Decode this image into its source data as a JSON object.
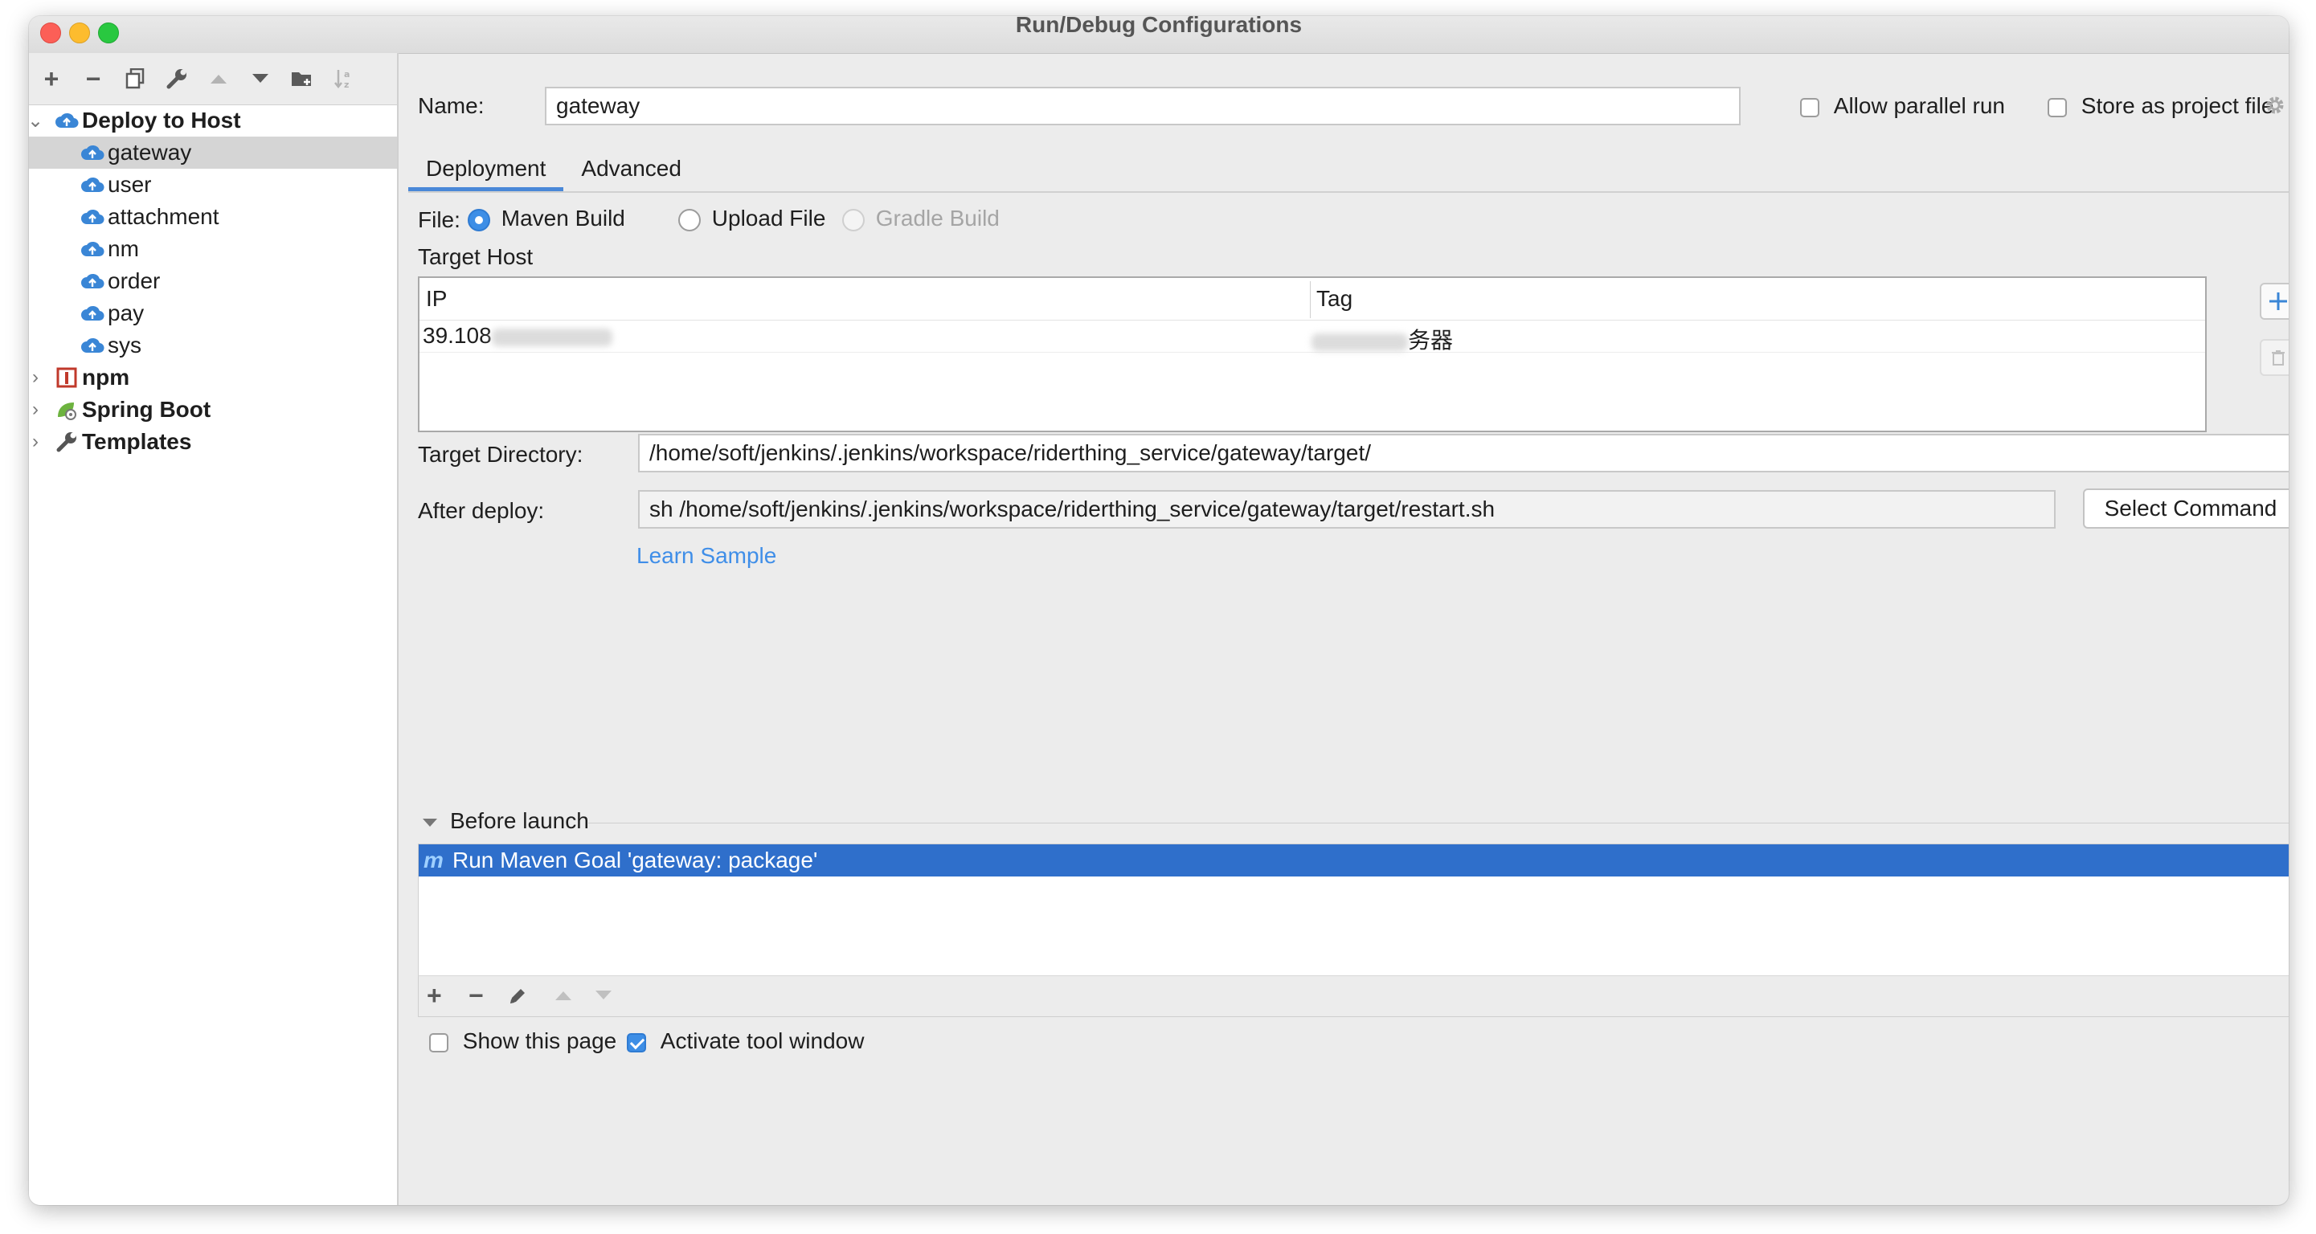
{
  "window": {
    "title": "Run/Debug Configurations"
  },
  "toolbar": {
    "add": "+",
    "remove": "−",
    "copy": "copy-icon",
    "edit": "wrench-icon",
    "up": "▲",
    "down": "▼",
    "folder": "folder-icon",
    "sort": "sort-icon"
  },
  "tree": {
    "deploy_group": "Deploy to Host",
    "items": [
      "gateway",
      "user",
      "attachment",
      "nm",
      "order",
      "pay",
      "sys"
    ],
    "npm": "npm",
    "spring_boot": "Spring Boot",
    "templates": "Templates"
  },
  "form": {
    "name_label": "Name:",
    "name_value": "gateway",
    "allow_parallel": "Allow parallel run",
    "store_project": "Store as project file",
    "tabs": [
      "Deployment",
      "Advanced"
    ],
    "file_label": "File:",
    "file_options": [
      "Maven Build",
      "Upload File",
      "Gradle Build"
    ],
    "target_host_label": "Target Host",
    "table_headers": [
      "IP",
      "Tag"
    ],
    "host_ip": "39.108",
    "host_tag": "务器",
    "target_dir_label": "Target Directory:",
    "target_dir_value": "/home/soft/jenkins/.jenkins/workspace/riderthing_service/gateway/target/",
    "after_deploy_label": "After deploy:",
    "after_deploy_value": "sh /home/soft/jenkins/.jenkins/workspace/riderthing_service/gateway/target/restart.sh",
    "select_command": "Select Command",
    "learn_sample": "Learn Sample",
    "before_launch": "Before launch",
    "launch_task": "Run Maven Goal 'gateway: package'",
    "show_page": "Show this page",
    "activate_tool": "Activate tool window"
  },
  "colors": {
    "accent": "#3d8ee6",
    "selection": "#2f6fcb",
    "link": "#3f8ee8"
  }
}
